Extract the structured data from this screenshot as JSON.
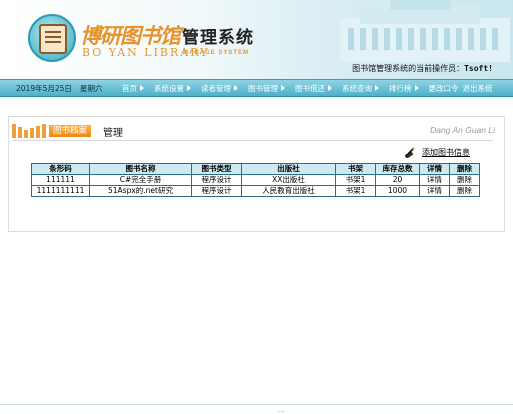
{
  "header": {
    "logo_cn": "博研图书馆",
    "logo_cn_2": "管理系统",
    "logo_en": "BO YAN LIBRARY",
    "logo_en_2": "MANAGE SYSTEM",
    "operator_label": "图书馆管理系统的当前操作员：",
    "operator_name": "Tsoft!"
  },
  "navbar": {
    "date": "2019年5月25日",
    "weekday": "星期六",
    "items": [
      {
        "label": "首页"
      },
      {
        "label": "系统设置"
      },
      {
        "label": "读者管理"
      },
      {
        "label": "图书管理"
      },
      {
        "label": "图书借还"
      },
      {
        "label": "系统查询"
      },
      {
        "label": "排行榜"
      },
      {
        "label": "更改口令"
      },
      {
        "label": "退出系统"
      }
    ]
  },
  "panel": {
    "title_badge": "图书档案",
    "title": "管理",
    "title_pinyin": "Dang An Guan Li",
    "add_link": "添加图书信息"
  },
  "table": {
    "headers": [
      "条形码",
      "图书名称",
      "图书类型",
      "出版社",
      "书架",
      "库存总数",
      "详情",
      "删除"
    ],
    "rows": [
      [
        "111111",
        "C#完全手册",
        "程序设计",
        "XX出版社",
        "书架1",
        "20",
        "详情",
        "删除"
      ],
      [
        "1111111111",
        "51Aspx的.net研究",
        "程序设计",
        "人民教育出版社",
        "书架1",
        "1000",
        "详情",
        "删除"
      ]
    ]
  },
  "footer": {
    "text": "..."
  },
  "colors": {
    "nav_bar": "#4eb0c8",
    "accent_orange": "#e98a14",
    "table_border": "#2a6f86",
    "table_header": "#cdeaf2"
  }
}
